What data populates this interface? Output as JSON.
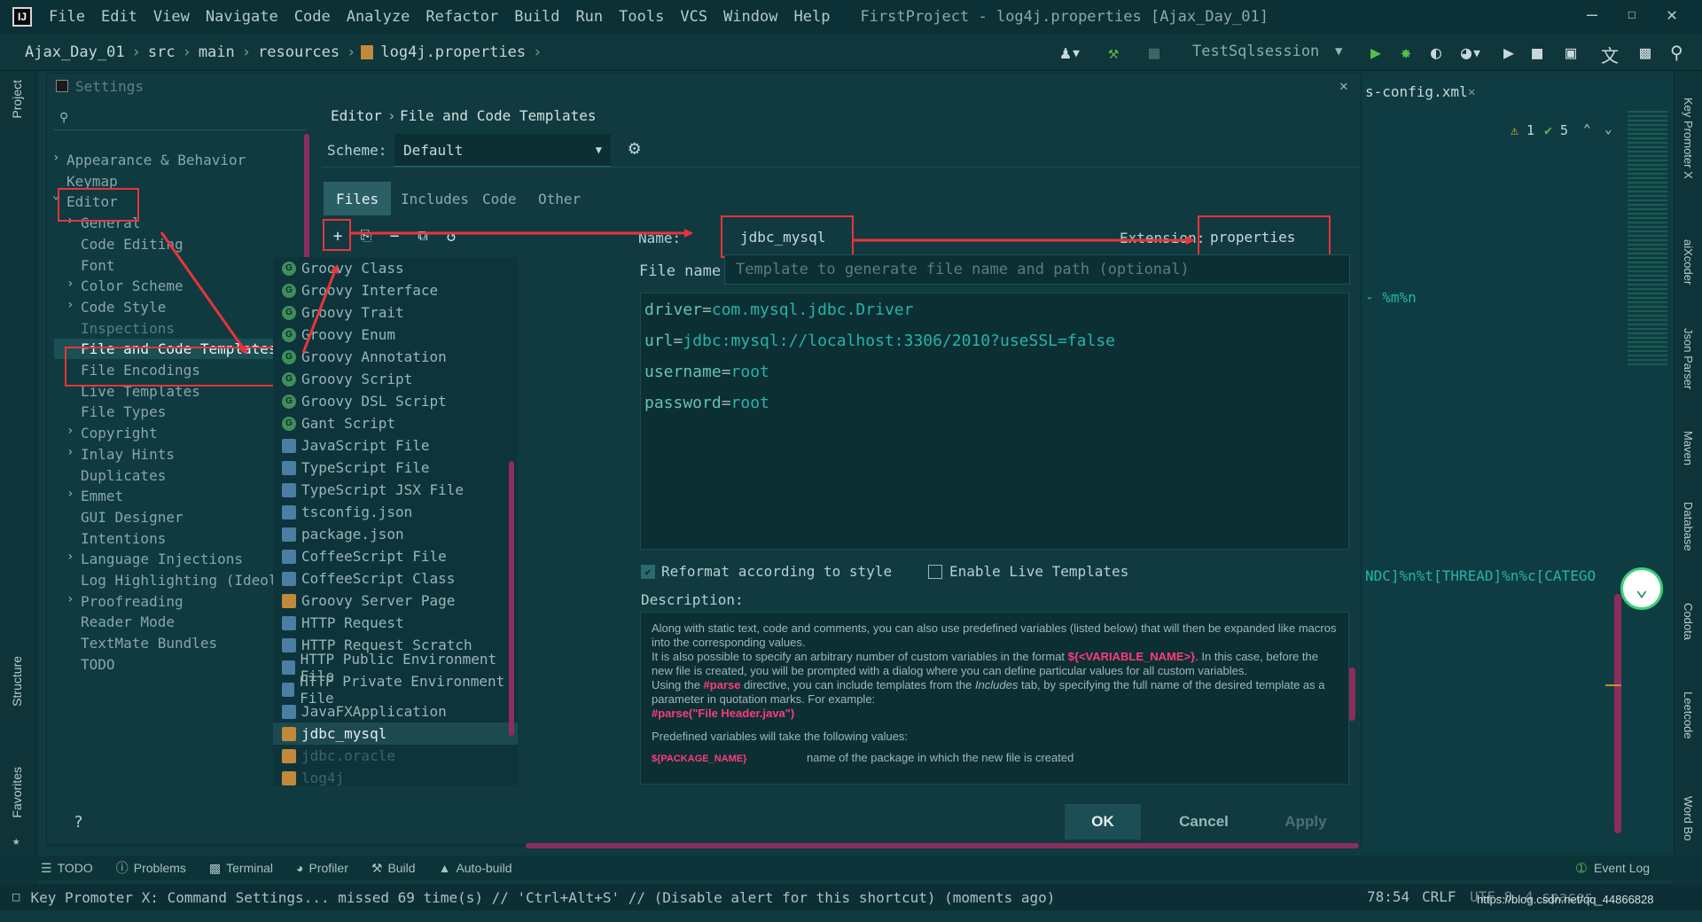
{
  "menubar": {
    "items": [
      "File",
      "Edit",
      "View",
      "Navigate",
      "Code",
      "Analyze",
      "Refactor",
      "Build",
      "Run",
      "Tools",
      "VCS",
      "Window",
      "Help"
    ],
    "window_title": "FirstProject - log4j.properties [Ajax_Day_01]"
  },
  "navbar": {
    "crumbs": [
      "Ajax_Day_01",
      "src",
      "main",
      "resources",
      "log4j.properties"
    ],
    "run_config": "TestSqlsession"
  },
  "editor_tab": {
    "label": "s-config.xml"
  },
  "inspections": {
    "warnings": "1",
    "ok": "5"
  },
  "editor_fragments": {
    "frag1": "- %m%n",
    "frag2": "NDC]%n%t[THREAD]%n%c[CATEGO"
  },
  "left_strip": {
    "project": "Project",
    "structure": "Structure",
    "favorites": "Favorites"
  },
  "right_strip": {
    "key_promoter": "Key Promoter X",
    "aixcoder": "aiXcoder",
    "json_parser": "Json Parser",
    "maven": "Maven",
    "database": "Database",
    "codota": "Codota",
    "leetcode": "Leetcode",
    "word_book": "Word Bo"
  },
  "dialog": {
    "title": "Settings",
    "breadcrumb_parent": "Editor",
    "breadcrumb_child": "File and Code Templates",
    "scheme_label": "Scheme:",
    "scheme_value": "Default",
    "tabs": [
      "Files",
      "Includes",
      "Code",
      "Other"
    ],
    "name_label": "Name:",
    "name_value": "jdbc_mysql",
    "extension_label": "Extension:",
    "extension_value": "properties",
    "filename_label": "File name:",
    "filename_placeholder": "Template to generate file name and path (optional)",
    "code_lines": [
      {
        "key": "driver",
        "value": "com.mysql.jdbc.Driver"
      },
      {
        "key": "url",
        "value": "jdbc:mysql://localhost:3306/2010?useSSL=false"
      },
      {
        "key": "username",
        "value": "root"
      },
      {
        "key": "password",
        "value": "root"
      }
    ],
    "reformat_label": "Reformat according to style",
    "live_templates_label": "Enable Live Templates",
    "description_label": "Description:",
    "description": {
      "p1": "Along with static text, code and comments, you can also use predefined variables (listed below) that will then be expanded like macros into the corresponding values.",
      "p2a": "It is also possible to specify an arbitrary number of custom variables in the format ",
      "p2var": "${<VARIABLE_NAME>}",
      "p2b": ". In this case, before the new file is created, you will be prompted with a dialog where you can define particular values for all custom variables.",
      "p3a": "Using the ",
      "p3parse": "#parse",
      "p3b": " directive, you can include templates from the ",
      "p3inc": "Includes",
      "p3c": " tab, by specifying the full name of the desired template as a parameter in quotation marks. For example:",
      "p3ex": "#parse(\"File Header.java\")",
      "p4": "Predefined variables will take the following values:",
      "var1": "${PACKAGE_NAME}",
      "var1desc": "name of the package in which the new file is created"
    },
    "buttons": {
      "ok": "OK",
      "cancel": "Cancel",
      "apply": "Apply",
      "help": "?"
    }
  },
  "settings_tree": [
    {
      "label": "Appearance & Behavior",
      "level": 0,
      "arrow": true
    },
    {
      "label": "Keymap",
      "level": 0,
      "arrow": false
    },
    {
      "label": "Editor",
      "level": 0,
      "arrow": true
    },
    {
      "label": "General",
      "level": 1,
      "arrow": true
    },
    {
      "label": "Code Editing",
      "level": 1,
      "arrow": false
    },
    {
      "label": "Font",
      "level": 1,
      "arrow": false
    },
    {
      "label": "Color Scheme",
      "level": 1,
      "arrow": true
    },
    {
      "label": "Code Style",
      "level": 1,
      "arrow": true
    },
    {
      "label": "Inspections",
      "level": 1,
      "arrow": false
    },
    {
      "label": "File and Code Templates",
      "level": 1,
      "arrow": false
    },
    {
      "label": "File Encodings",
      "level": 1,
      "arrow": false
    },
    {
      "label": "Live Templates",
      "level": 1,
      "arrow": false
    },
    {
      "label": "File Types",
      "level": 1,
      "arrow": false
    },
    {
      "label": "Copyright",
      "level": 1,
      "arrow": true
    },
    {
      "label": "Inlay Hints",
      "level": 1,
      "arrow": true
    },
    {
      "label": "Duplicates",
      "level": 1,
      "arrow": false
    },
    {
      "label": "Emmet",
      "level": 1,
      "arrow": true
    },
    {
      "label": "GUI Designer",
      "level": 1,
      "arrow": false
    },
    {
      "label": "Intentions",
      "level": 1,
      "arrow": false
    },
    {
      "label": "Language Injections",
      "level": 1,
      "arrow": true
    },
    {
      "label": "Log Highlighting (Ideolog",
      "level": 1,
      "arrow": false
    },
    {
      "label": "Proofreading",
      "level": 1,
      "arrow": true
    },
    {
      "label": "Reader Mode",
      "level": 1,
      "arrow": false
    },
    {
      "label": "TextMate Bundles",
      "level": 1,
      "arrow": false
    },
    {
      "label": "TODO",
      "level": 1,
      "arrow": false
    }
  ],
  "template_files": [
    {
      "label": "Groovy Class",
      "icon": "groovy-icon"
    },
    {
      "label": "Groovy Interface",
      "icon": "groovy-icon"
    },
    {
      "label": "Groovy Trait",
      "icon": "groovy-icon"
    },
    {
      "label": "Groovy Enum",
      "icon": "groovy-icon"
    },
    {
      "label": "Groovy Annotation",
      "icon": "groovy-icon"
    },
    {
      "label": "Groovy Script",
      "icon": "groovy-icon"
    },
    {
      "label": "Groovy DSL Script",
      "icon": "groovy-icon"
    },
    {
      "label": "Gant Script",
      "icon": "groovy-icon"
    },
    {
      "label": "JavaScript File",
      "icon": "js-file-icon"
    },
    {
      "label": "TypeScript File",
      "icon": "ts-file-icon"
    },
    {
      "label": "TypeScript JSX File",
      "icon": "tsx-file-icon"
    },
    {
      "label": "tsconfig.json",
      "icon": "json-file-icon"
    },
    {
      "label": "package.json",
      "icon": "json-file-icon"
    },
    {
      "label": "CoffeeScript File",
      "icon": "coffee-file-icon"
    },
    {
      "label": "CoffeeScript Class",
      "icon": "coffee-file-icon"
    },
    {
      "label": "Groovy Server Page",
      "icon": "gsp-file-icon"
    },
    {
      "label": "HTTP Request",
      "icon": "http-file-icon"
    },
    {
      "label": "HTTP Request Scratch",
      "icon": "http-file-icon"
    },
    {
      "label": "HTTP Public Environment File",
      "icon": "http-env-icon"
    },
    {
      "label": "HTTP Private Environment File",
      "icon": "http-env-icon"
    },
    {
      "label": "JavaFXApplication",
      "icon": "javafx-file-icon"
    },
    {
      "label": "jdbc_mysql",
      "icon": "properties-file-icon"
    },
    {
      "label": "jdbc.oracle",
      "icon": "properties-file-icon"
    },
    {
      "label": "log4j",
      "icon": "properties-file-icon"
    }
  ],
  "toolwindows": [
    "TODO",
    "Problems",
    "Terminal",
    "Profiler",
    "Build",
    "Auto-build"
  ],
  "event_log": "Event Log",
  "status": {
    "message": "Key Promoter X: Command Settings... missed 69 time(s) // 'Ctrl+Alt+S' // (Disable alert for this shortcut) (moments ago)",
    "position": "78:54",
    "line_sep": "CRLF",
    "encoding": "UTF-8",
    "indent": "4 spaces",
    "watermark": "https://blog.csdn.net/qq_44866828"
  },
  "colors": {
    "accent": "#2a5f66",
    "annotation_red": "#e8343a",
    "code_key": "#25b5aa",
    "highlight": "#ff3b7a"
  }
}
